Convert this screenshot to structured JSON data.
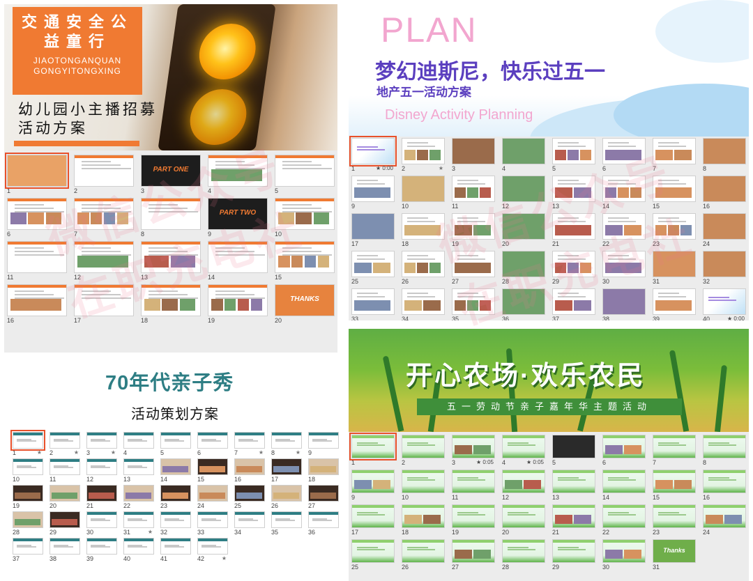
{
  "quadrants": [
    {
      "id": "traffic",
      "title_zh": "交通安全公益童行",
      "title_en": "JIAOTONGANQUAN GONGYITONGXING",
      "subtitle": "幼儿园小主播招募活动方案",
      "slide_count": 20,
      "columns": 5,
      "accent": "#f07a32",
      "selected": 1,
      "special": {
        "3": "PART ONE",
        "9": "PART TWO",
        "20": "THANKS"
      }
    },
    {
      "id": "disney",
      "plan": "PLAN",
      "title": "梦幻迪斯尼，快乐过五一",
      "subtitle": "地产五一活动方案",
      "english": "Disney Activity Planning",
      "slide_count": 40,
      "columns": 8,
      "accent": "#5b3fbf",
      "selected": 1,
      "badges": {
        "1": "0:00",
        "40": "0:00"
      },
      "stars": [
        2
      ]
    },
    {
      "id": "seventies",
      "title": "70年代亲子秀",
      "subtitle": "活动策划方案",
      "slide_count": 42,
      "columns": 9,
      "accent": "#2e7e84",
      "selected": 1,
      "stars": [
        1,
        2,
        3,
        7,
        8,
        31,
        42
      ]
    },
    {
      "id": "farm",
      "title": "开心农场·欢乐农民",
      "ribbon": "五一劳动节亲子嘉年华主题活动",
      "slide_count": 31,
      "columns": 8,
      "accent": "#4fae4a",
      "selected": 1,
      "badges": {
        "3": "0:05",
        "4": "0:05"
      },
      "stars": [],
      "special": {
        "31": "Thanks"
      }
    }
  ],
  "watermark": {
    "line1": "微信公众号",
    "line2": "在职充电社"
  }
}
